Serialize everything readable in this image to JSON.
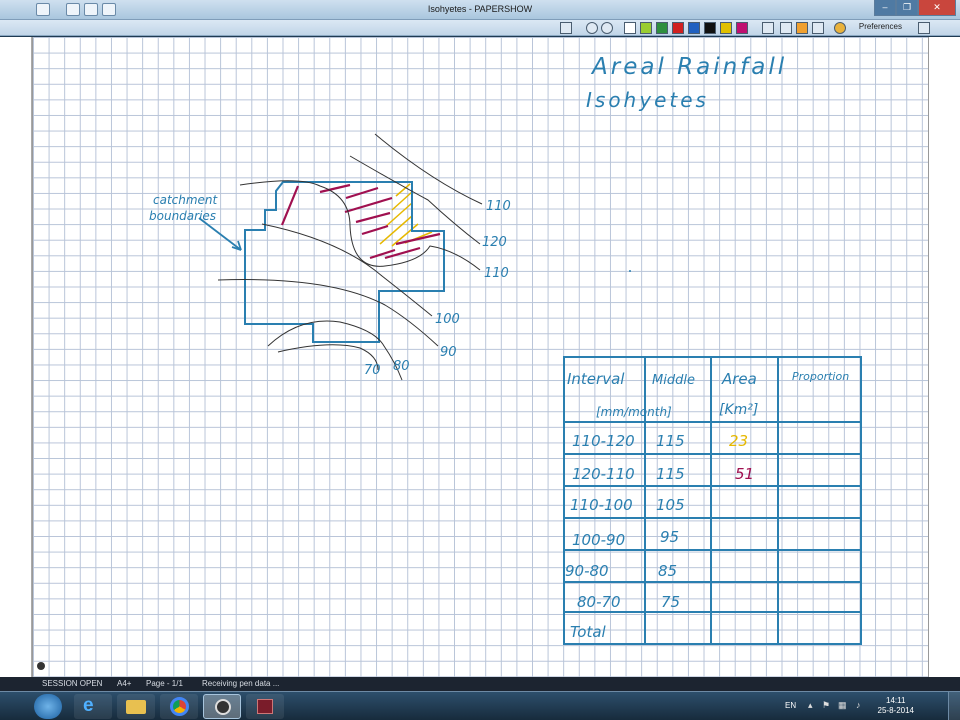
{
  "window": {
    "title": "Isohyetes - PAPERSHOW",
    "prefs_label": "Preferences",
    "min": "–",
    "max": "❐",
    "close": "✕"
  },
  "page": {
    "heading_line1": "Areal Rainfall",
    "heading_line2": "Isohyetes",
    "annotation_line1": "catchment",
    "annotation_line2": "boundaries",
    "isohyet_labels": [
      "110",
      "120",
      "110",
      "100",
      "90",
      "70",
      "80"
    ]
  },
  "table": {
    "headers": [
      "Interval",
      "Middle",
      "Area",
      "Proportion"
    ],
    "units": [
      "[mm/month]",
      "[Km²]"
    ],
    "rows": [
      [
        "110-120",
        "115",
        "23",
        ""
      ],
      [
        "120-110",
        "115",
        "51",
        ""
      ],
      [
        "110-100",
        "105",
        "",
        ""
      ],
      [
        "100-90",
        "95",
        "",
        ""
      ],
      [
        "90-80",
        "85",
        "",
        ""
      ],
      [
        "80-70",
        "75",
        "",
        ""
      ],
      [
        "Total",
        "",
        "",
        ""
      ]
    ],
    "colors": {
      "ink": "#2a7fb0",
      "yellow": "#e6b800",
      "magenta": "#a01050"
    }
  },
  "status": {
    "session": "SESSION OPEN",
    "paper": "A4+",
    "page": "Page - 1/1",
    "message": "Receiving pen data ..."
  },
  "taskbar": {
    "lang": "EN",
    "time": "14:11",
    "date": "25-8-2014"
  }
}
